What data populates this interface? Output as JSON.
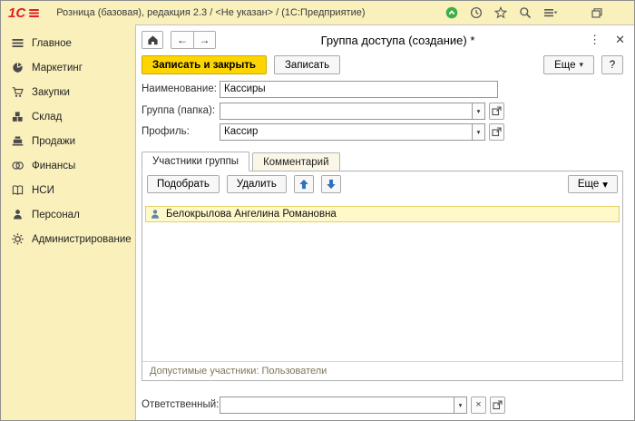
{
  "titlebar": {
    "logo": "1С",
    "title": "Розница (базовая), редакция 2.3 / <Не указан> / (1С:Предприятие)"
  },
  "icons": {
    "back": "←",
    "forward": "→",
    "more_vertical": "⋮",
    "close": "✕",
    "caret": "▾",
    "clear": "×"
  },
  "sidebar": {
    "items": [
      {
        "label": "Главное"
      },
      {
        "label": "Маркетинг"
      },
      {
        "label": "Закупки"
      },
      {
        "label": "Склад"
      },
      {
        "label": "Продажи"
      },
      {
        "label": "Финансы"
      },
      {
        "label": "НСИ"
      },
      {
        "label": "Персонал"
      },
      {
        "label": "Администрирование"
      }
    ]
  },
  "form": {
    "title": "Группа доступа (создание) *",
    "buttons": {
      "save_and_close": "Записать и закрыть",
      "save": "Записать",
      "more": "Еще",
      "help": "?"
    },
    "fields": {
      "name": {
        "label": "Наименование:",
        "value": "Кассиры"
      },
      "folder": {
        "label": "Группа (папка):",
        "value": ""
      },
      "profile": {
        "label": "Профиль:",
        "value": "Кассир"
      },
      "responsible": {
        "label": "Ответственный:",
        "value": ""
      }
    },
    "tabs": {
      "members": "Участники группы",
      "comment": "Комментарий"
    },
    "members": {
      "pick": "Подобрать",
      "delete": "Удалить",
      "more": "Еще",
      "rows": [
        {
          "name": "Белокрылова Ангелина Романовна"
        }
      ],
      "footer": "Допустимые участники: Пользователи"
    }
  },
  "colors": {
    "theme_yellow": "#faf0bc",
    "primary_button": "#fed500",
    "selection_row": "#fff9c9"
  }
}
